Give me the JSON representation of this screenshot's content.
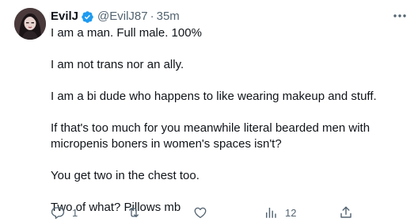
{
  "tweet": {
    "display_name": "EvilJ",
    "handle": "@EvilJ87",
    "separator": "·",
    "time": "35m",
    "paragraphs": [
      "I am a man. Full male. 100%",
      "I am not trans nor an ally.",
      "I am a bi dude who happens to like wearing makeup and stuff.",
      "If that's too much for you meanwhile literal bearded men with micropenis boners in women's spaces isn't?",
      "You get two in the chest too.",
      "Two of what? Pillows mb"
    ]
  },
  "actions": {
    "reply_count": "1",
    "retweet_count": "",
    "like_count": "",
    "views_count": "12"
  },
  "icons": {
    "verified": "verified-badge-icon",
    "more": "more-dots-icon",
    "reply": "reply-icon",
    "retweet": "retweet-icon",
    "like": "heart-icon",
    "views": "views-bar-chart-icon",
    "share": "share-icon"
  },
  "colors": {
    "text": "#0f1419",
    "secondary": "#536471",
    "verified": "#1d9bf0"
  }
}
